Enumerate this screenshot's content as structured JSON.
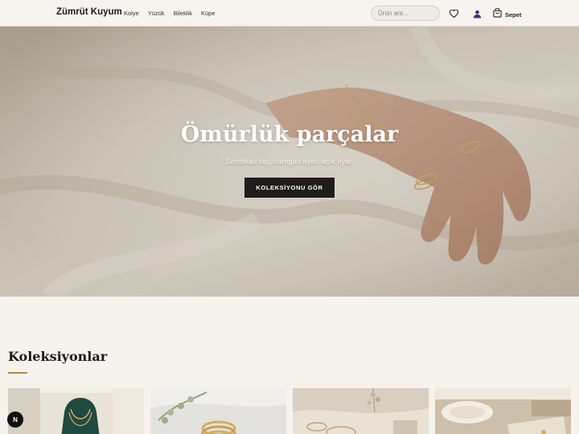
{
  "brand": {
    "name": "Zümrüt Kuyum"
  },
  "nav": {
    "items": [
      {
        "label": "Kolye"
      },
      {
        "label": "Yüzük"
      },
      {
        "label": "Bileklik"
      },
      {
        "label": "Küpe"
      }
    ]
  },
  "search": {
    "placeholder": "Ürün ara..."
  },
  "header_icons": {
    "wishlist": "heart-icon",
    "account": "user-icon",
    "cart": "bag-icon"
  },
  "cart": {
    "label": "Sepet"
  },
  "hero": {
    "title": "Ömürlük parçalar",
    "subtitle": "Sertifikalı taş, damgalı ayar, açık fiyat.",
    "cta_label": "KOLEKSİYONU GÖR"
  },
  "collections": {
    "title": "Koleksiyonlar",
    "accent_color": "#b48a45"
  },
  "floating_badge": {
    "label": "N"
  },
  "colors": {
    "page_bg": "#f6f2ec",
    "button_dark": "#1f1d1b"
  }
}
